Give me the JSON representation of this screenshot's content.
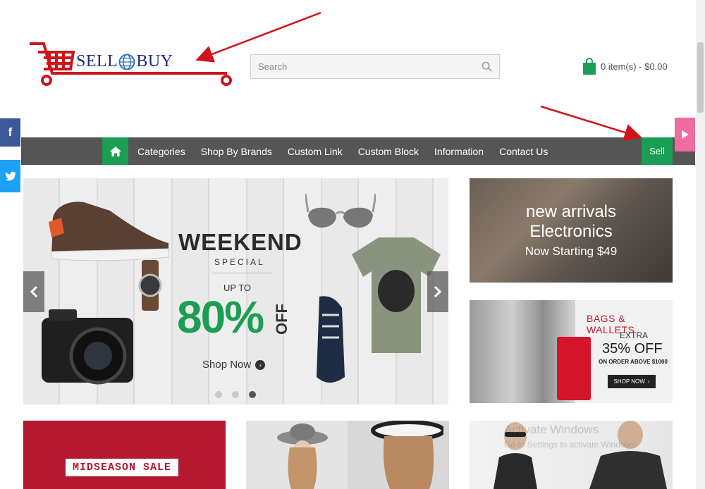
{
  "header": {
    "logo": {
      "part1": "SELL",
      "part2": "BUY"
    },
    "search": {
      "placeholder": "Search"
    },
    "cart": {
      "summary": "0 item(s) - $0.00"
    }
  },
  "nav": {
    "items": [
      "Categories",
      "Shop By Brands",
      "Custom Link",
      "Custom Block",
      "Information",
      "Contact Us"
    ],
    "sell_label": "Sell"
  },
  "social": {
    "facebook": "f"
  },
  "slider": {
    "title": "WEEKEND",
    "subtitle": "SPECIAL",
    "upto": "UP TO",
    "percent": "80%",
    "off": "OFF",
    "cta": "Shop Now",
    "active_dot": 3,
    "dot_count": 3
  },
  "banner_arrivals": {
    "line1": "new arrivals",
    "line2": "Electronics",
    "line3": "Now Starting $49"
  },
  "banner_bags": {
    "heading": "BAGS & WALLETS",
    "extra": "EXTRA",
    "percent": "35% OFF",
    "condition": "ON ORDER ABOVE $1000",
    "button": "SHOP NOW"
  },
  "bottom": {
    "midseason": "MIDSEASON SALE"
  },
  "watermark": {
    "line1": "Activate Windows",
    "line2": "Go to Settings to activate Windows."
  },
  "colors": {
    "accent": "#1a9e53",
    "nav": "#555555",
    "annotation": "#d0141b",
    "facebook": "#3b5998",
    "twitter": "#1da1f2",
    "pink": "#f06ba0"
  }
}
